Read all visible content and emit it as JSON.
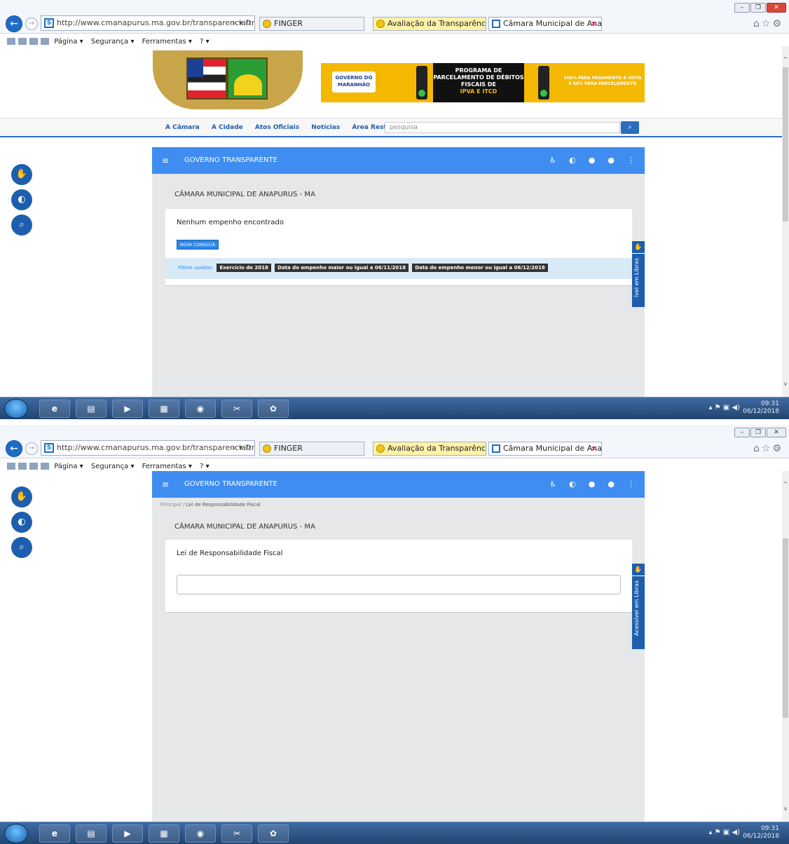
{
  "screens": [
    {
      "browser": {
        "url": "http://www.cmanapurus.ma.gov.br/transparencia/tra",
        "url_tools": "⌕ ▾ ↻",
        "tabs": [
          "FINGER",
          "Avaliação da Transparência do...",
          "Câmara Municipal de Anap..."
        ],
        "close_tab": "×",
        "menu": [
          "Página ▾",
          "Segurança ▾",
          "Ferramentas ▾",
          "? ▾"
        ]
      },
      "ad": {
        "gov": "GOVERNO DO MARANHÃO",
        "title": "PROGRAMA DE PARCELAMENTO DE DÉBITOS FISCAIS DE",
        "title_highlight": "IPVA E ITCD",
        "side": "100% PARA PAGAMENTO À VISTA E 60% PARA PARCELAMENTO"
      },
      "nav": {
        "links": [
          "A Câmara",
          "A Cidade",
          "Atos Oficiais",
          "Notícias",
          "Área Restrita ▾"
        ],
        "search_placeholder": "pesquisa"
      },
      "app": {
        "title": "GOVERNO TRANSPARENTE",
        "org": "CÂMARA MUNICIPAL DE ANAPURUS - MA",
        "message": "Nenhum empenho encontrado",
        "button": "NOVA CONSULTA",
        "filters_label": "Filtros usados:",
        "filters": [
          "Exercício de 2018",
          "Data do empenho maior ou igual a 06/11/2018",
          "Data do empenho menor ou igual a 06/12/2018"
        ],
        "libras": "ível em Libras"
      },
      "clock": {
        "time": "09:31",
        "date": "06/12/2018"
      }
    },
    {
      "browser": {
        "url": "http://www.cmanapurus.ma.gov.br/transparencia/tra",
        "url_tools": "⌕ ▾ ↻",
        "tabs": [
          "FINGER",
          "Avaliação da Transparência do...",
          "Câmara Municipal de Anap..."
        ],
        "close_tab": "×",
        "menu": [
          "Página ▾",
          "Segurança ▾",
          "Ferramentas ▾",
          "? ▾"
        ]
      },
      "app": {
        "title": "GOVERNO TRANSPARENTE",
        "breadcrumb_root": "Principal",
        "breadcrumb_sep": "/",
        "breadcrumb_current": "Lei de Responsabilidade Fiscal",
        "org": "CÂMARA MUNICIPAL DE ANAPURUS - MA",
        "heading": "Lei de Responsabilidade Fiscal",
        "libras": "Acessível em Libras"
      },
      "clock": {
        "time": "09:31",
        "date": "06/12/2018"
      }
    }
  ],
  "colors": {
    "accent": "#3f8df0",
    "nav_blue": "#2b6dbe",
    "ad_yellow": "#f5b800"
  }
}
